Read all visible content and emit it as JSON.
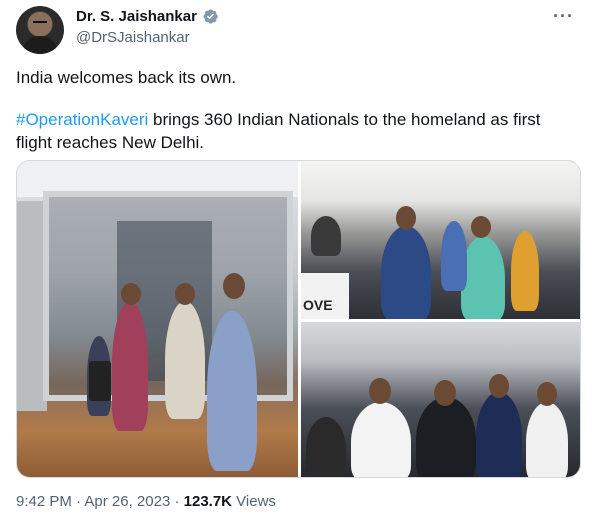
{
  "author": {
    "name": "Dr. S. Jaishankar",
    "handle": "@DrSJaishankar",
    "verified_color": "#829aab"
  },
  "more_label": "···",
  "tweet": {
    "line1": "India welcomes back its own.",
    "hashtag": "#OperationKaveri",
    "line2_rest": " brings 360 Indian Nationals to the homeland as first flight reaches New Delhi."
  },
  "media": {
    "photos": [
      "photo-1",
      "photo-2",
      "photo-3"
    ],
    "sign_text": "OVE"
  },
  "meta": {
    "time": "9:42 PM",
    "sep1": " · ",
    "date": "Apr 26, 2023",
    "sep2": " · ",
    "views_count": "123.7K",
    "views_label": " Views"
  },
  "colors": {
    "hashtag": "#1d9bf0",
    "secondary_text": "#536471",
    "primary_text": "#0f1419"
  }
}
